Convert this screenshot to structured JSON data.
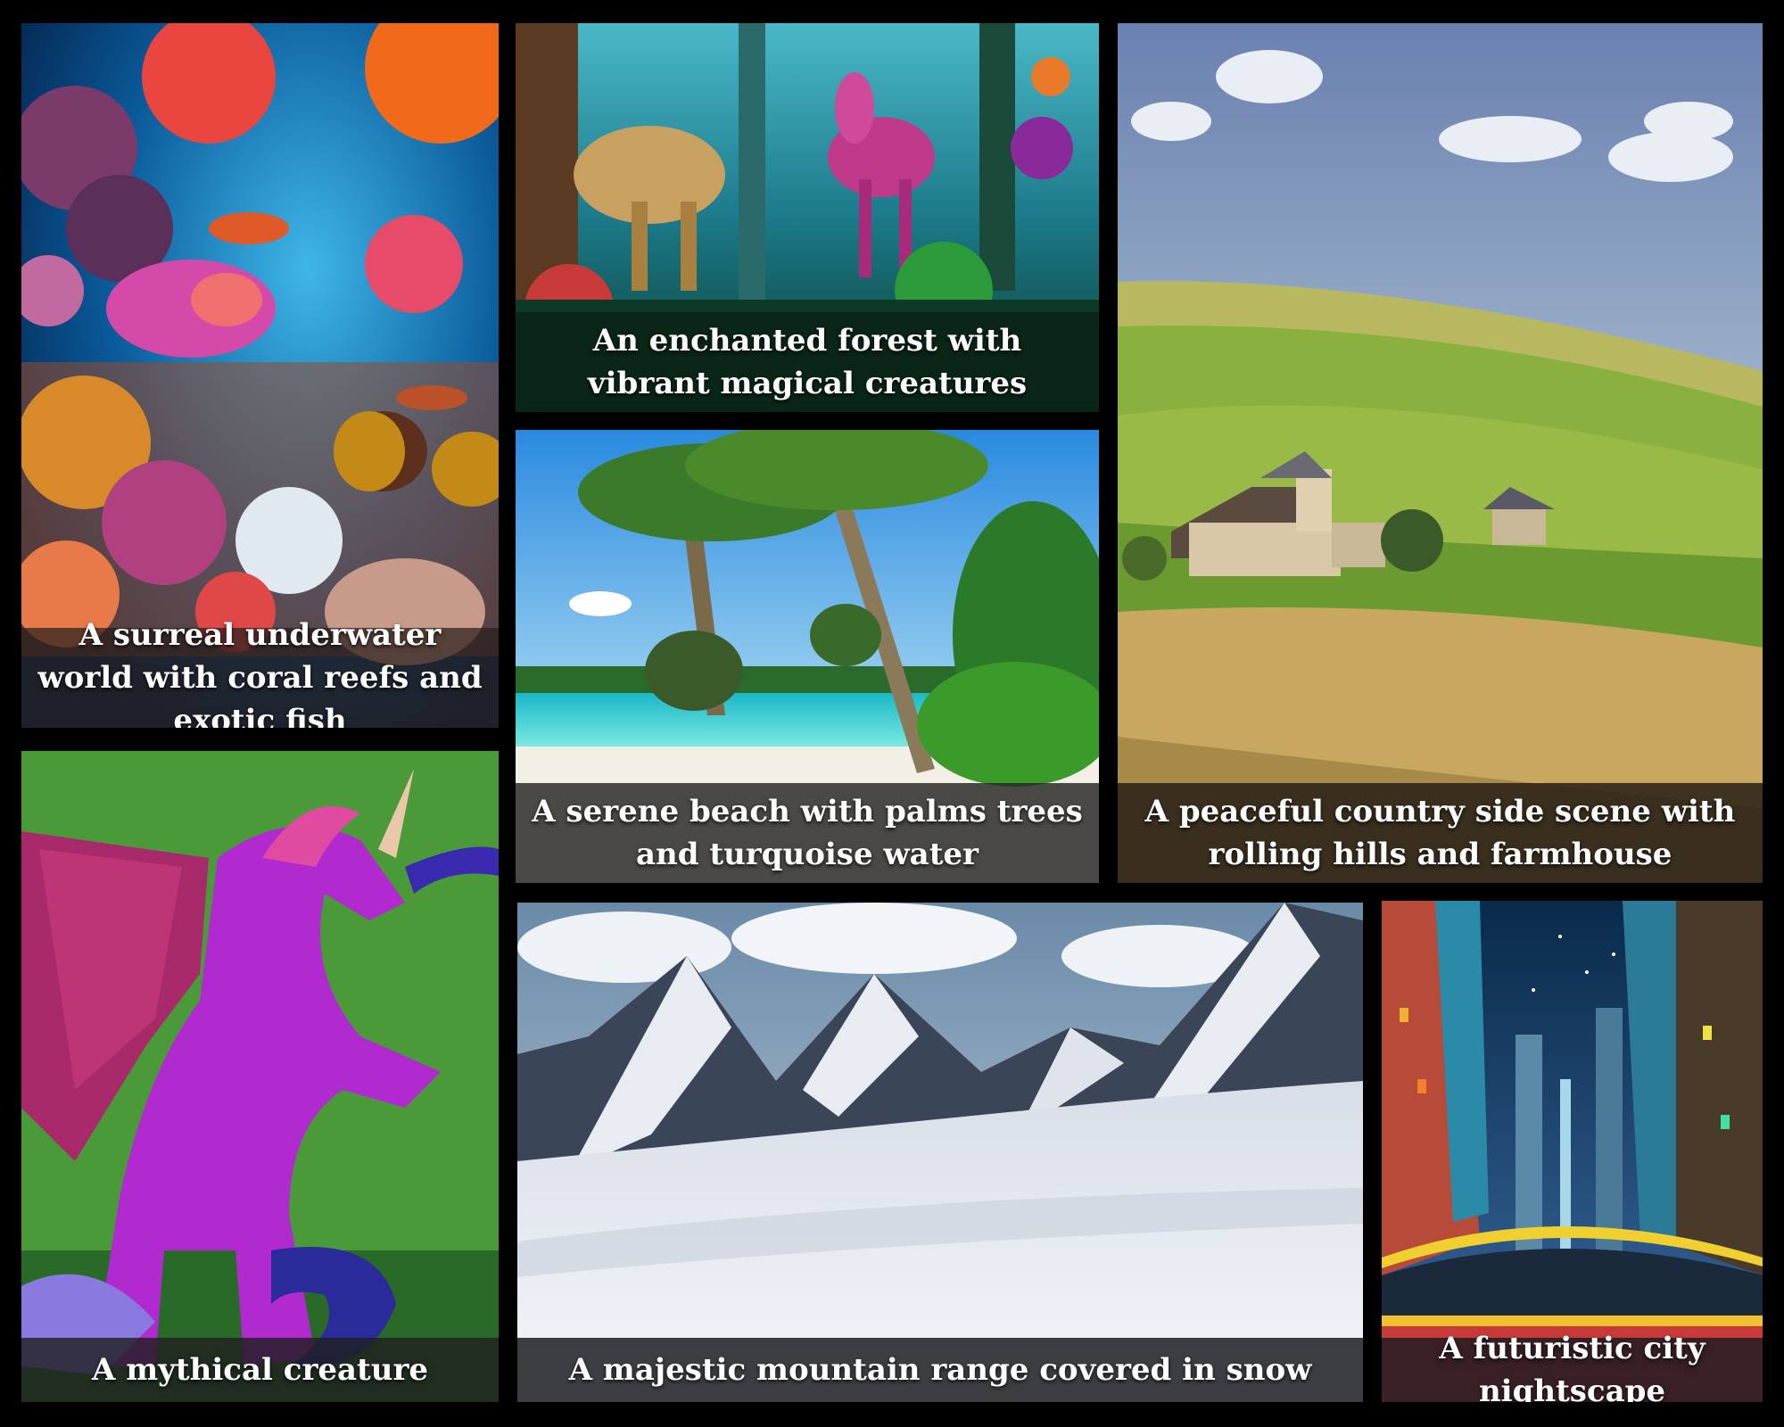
{
  "tiles": [
    {
      "id": "underwater",
      "caption": "A surreal underwater world with coral reefs and exotic fish"
    },
    {
      "id": "forest",
      "caption": "An enchanted forest with vibrant magical creatures"
    },
    {
      "id": "beach",
      "caption": "A serene beach with palms trees and turquoise water"
    },
    {
      "id": "country",
      "caption": "A peaceful country side scene with rolling hills and farmhouse"
    },
    {
      "id": "creature",
      "caption": "A mythical creature"
    },
    {
      "id": "mountain",
      "caption": "A majestic mountain range covered in snow"
    },
    {
      "id": "city",
      "caption": "A futuristic city nightscape"
    }
  ],
  "colors": {
    "background": "#000000",
    "caption_text": "#ffffff"
  }
}
